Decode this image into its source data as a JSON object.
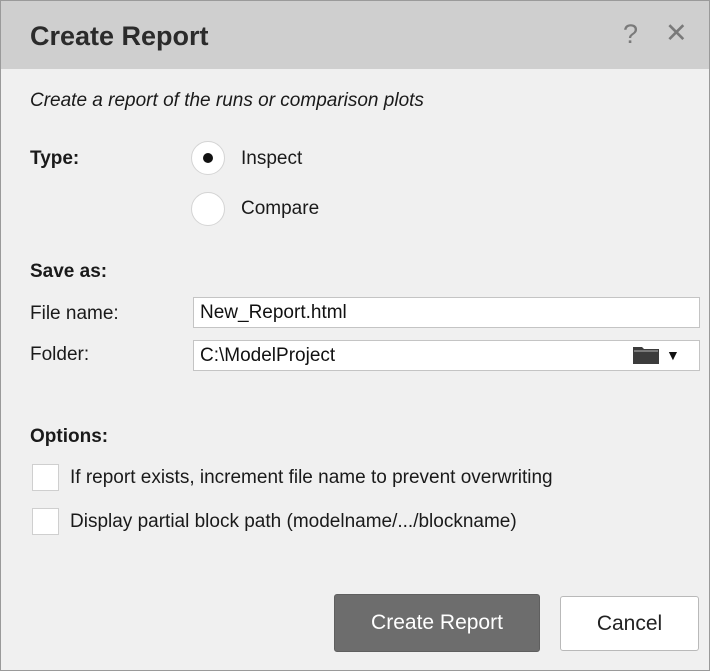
{
  "dialog": {
    "title": "Create Report",
    "help_icon": "?",
    "close_icon": "✕",
    "subtitle": "Create a report of the runs or comparison plots"
  },
  "type": {
    "label": "Type:",
    "options": [
      {
        "label": "Inspect",
        "selected": true
      },
      {
        "label": "Compare",
        "selected": false
      }
    ]
  },
  "save_as": {
    "heading": "Save as:",
    "file_name_label": "File name:",
    "file_name_value": "New_Report.html",
    "folder_label": "Folder:",
    "folder_value": "C:\\ModelProject",
    "folder_browse_icon": "folder-icon",
    "folder_dropdown_icon": "▼"
  },
  "options": {
    "heading": "Options:",
    "items": [
      {
        "label": "If report exists, increment file name to prevent overwriting",
        "checked": false
      },
      {
        "label": "Display partial block path (modelname/.../blockname)",
        "checked": false
      }
    ]
  },
  "buttons": {
    "create": "Create Report",
    "cancel": "Cancel"
  }
}
